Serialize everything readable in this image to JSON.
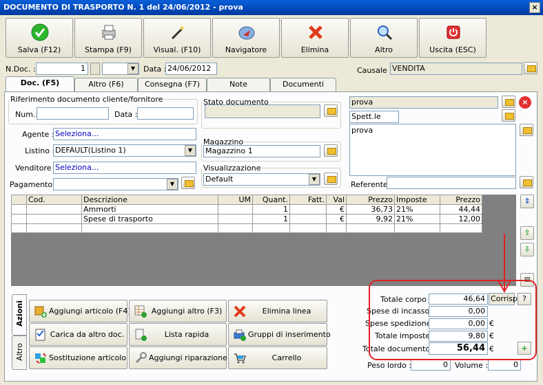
{
  "window": {
    "title": "DOCUMENTO DI TRASPORTO N. 1  del 24/06/2012 - prova",
    "close": "×"
  },
  "toolbar": {
    "buttons": [
      {
        "label": "Salva (F12)"
      },
      {
        "label": "Stampa (F9)"
      },
      {
        "label": "Visual. (F10)"
      },
      {
        "label": "Navigatore"
      },
      {
        "label": "Elimina"
      },
      {
        "label": "Altro"
      },
      {
        "label": "Uscita (ESC)"
      }
    ]
  },
  "header": {
    "ndoc_label": "N.Doc. :",
    "ndoc_value": "1",
    "data_label": "Data :",
    "data_value": "24/06/2012",
    "causale_label": "Causale :",
    "causale_value": "VENDITA"
  },
  "tabs": [
    "Doc. (F5)",
    "Altro (F6)",
    "Consegna (F7)",
    "Note",
    "Documenti"
  ],
  "riferimento": {
    "legend": "Riferimento documento cliente/fornitore",
    "num_label": "Num.:",
    "num_value": "",
    "data_label": "Data :",
    "data_value": ""
  },
  "agente": {
    "label": "Agente :",
    "value": "Seleziona..."
  },
  "listino": {
    "label": "Listino :",
    "value": "DEFAULT(Listino 1)"
  },
  "venditore": {
    "label": "Venditore :",
    "value": "Seleziona..."
  },
  "pagamento": {
    "label": "Pagamento :",
    "value": ""
  },
  "stato": {
    "legend": "Stato documento",
    "value": ""
  },
  "magazzino": {
    "legend": "Magazzino",
    "value": "Magazzino 1"
  },
  "visualizzazione": {
    "legend": "Visualizzazione",
    "value": "Default"
  },
  "cliente": {
    "name": "prova",
    "title": "Spett.le",
    "address": "prova",
    "referente_label": "Referente",
    "referente_value": ""
  },
  "grid": {
    "columns": [
      "Cod.",
      "Descrizione",
      "UM",
      "Quant.",
      "Fatt.",
      "Val",
      "Prezzo",
      "Imposte",
      "Prezzo"
    ],
    "rows": [
      {
        "cod": "",
        "descrizione": "Ammorti",
        "um": "",
        "quant": "1",
        "fatt": "",
        "val": "€",
        "prezzo": "36,73",
        "imposte": "21%",
        "prezzo2": "44,44"
      },
      {
        "cod": "",
        "descrizione": "Spese di trasporto",
        "um": "",
        "quant": "1",
        "fatt": "",
        "val": "€",
        "prezzo": "9,92",
        "imposte": "21%",
        "prezzo2": "12,00"
      }
    ]
  },
  "side_tabs": [
    "Azioni",
    "Altro"
  ],
  "actions": [
    {
      "label": "Aggiungi articolo (F4)"
    },
    {
      "label": "Aggiungi altro (F3)"
    },
    {
      "label": "Elimina linea"
    },
    {
      "label": "Carica da altro doc."
    },
    {
      "label": "Lista rapida"
    },
    {
      "label": "Gruppi di inserimento"
    },
    {
      "label": "Sostituzione articolo"
    },
    {
      "label": "Aggiungi riparazione"
    },
    {
      "label": "Carrello"
    }
  ],
  "totals": {
    "corpo_label": "Totale corpo :",
    "corpo_value": "46,64",
    "corrisp": "Corrisp.",
    "help": "?",
    "incasso_label": "Spese di incasso :",
    "incasso_value": "0,00",
    "spedizione_label": "Spese spedizione :",
    "spedizione_value": "0,00",
    "imposte_label": "Totale imposte :",
    "imposte_value": "9,80",
    "documento_label": "Totale documento :",
    "documento_value": "56,44",
    "currency": "€",
    "peso_label": "Peso lordo :",
    "peso_value": "0",
    "volume_label": "Volume :",
    "volume_value": "0"
  },
  "colors": {
    "annotation": "#e02020",
    "titlebar": "#0054e3",
    "panel": "#fcfcfe"
  },
  "icons": {
    "save": "check-icon",
    "print": "printer-icon",
    "preview": "magic-wand-icon",
    "navigator": "compass-icon",
    "delete": "red-x-icon",
    "other": "magnifier-icon",
    "exit": "power-icon"
  }
}
